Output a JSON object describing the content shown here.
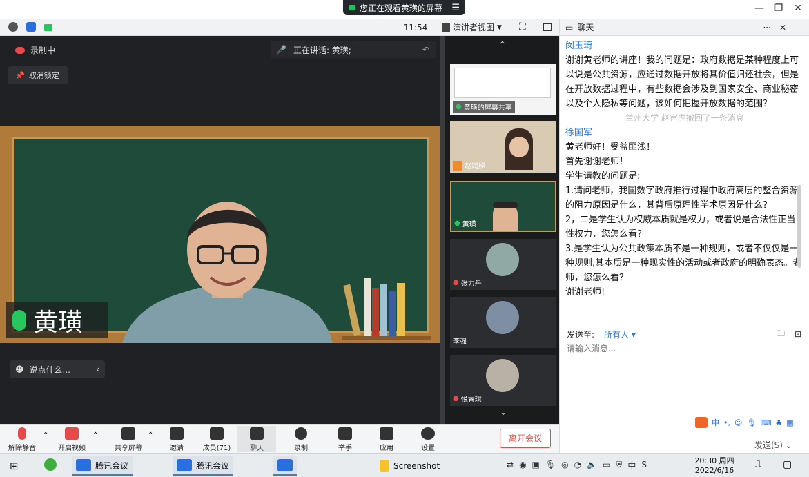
{
  "banner": {
    "viewing_text": "您正在观看黄璜的屏幕"
  },
  "toolbar": {
    "time": "11:54",
    "view_label": "演讲者视图"
  },
  "stage": {
    "recording_text": "录制中",
    "unlock_label": "取消锁定",
    "speaking_text": "正在讲话: 黄璜;",
    "speaker_name": "黄璜",
    "say_placeholder": "说点什么..."
  },
  "thumbnails": [
    {
      "label": "黄璜的屏幕共享"
    },
    {
      "label": "赵润娣"
    },
    {
      "label": "黄璜"
    },
    {
      "label": "张力丹"
    },
    {
      "label": "李强"
    },
    {
      "label": "悦睿琪"
    }
  ],
  "bottom_toolbar": {
    "unmute": "解除静音",
    "start_video": "开启视频",
    "share_screen": "共享屏幕",
    "invite": "邀请",
    "members": "成员(71)",
    "chat": "聊天",
    "record": "录制",
    "raise_hand": "举手",
    "apps": "应用",
    "settings": "设置",
    "leave": "离开会议"
  },
  "chat": {
    "title": "聊天",
    "messages": [
      {
        "sender": "闵玉琦",
        "lines": [
          "谢谢黄老师的讲座！我的问题是：政府数据是某种程度上可以说是公共资源，应通过数据开放将其价值归还社会，但是在开放数据过程中，有些数据会涉及到国家安全、商业秘密以及个人隐私等问题，该如何把握开放数据的范围？"
        ]
      },
      {
        "sender": "徐国军",
        "lines": [
          "黄老师好！受益匪浅！",
          "首先谢谢老师！",
          "学生请教的问题是:",
          "1.请问老师，我国数字政府推行过程中政府高层的整合资源的阻力原因是什么，其背后原理性学术原因是什么？",
          "2，二是学生认为权威本质就是权力，或者说是合法性正当性权力，您怎么看？",
          "3.是学生认为公共政策本质不是一种规则，或者不仅仅是一种规则,其本质是一种现实性的活动或者政府的明确表态。老师，您怎么看？",
          " 谢谢老师!"
        ]
      }
    ],
    "recall_notice": "兰州大学 赵官虎撤回了一条消息",
    "send_to_label": "发送至:",
    "send_to_target": "所有人",
    "input_placeholder": "请输入消息...",
    "send_label": "发送(S)"
  },
  "taskbar": {
    "apps": [
      "腾讯会议",
      "腾讯会议",
      "",
      "Screenshot"
    ],
    "time": "20:30 周四",
    "date": "2022/6/16"
  },
  "colors": {
    "accent": "#2a7ad8",
    "danger": "#e54b4b",
    "mic_green": "#27c75e"
  }
}
